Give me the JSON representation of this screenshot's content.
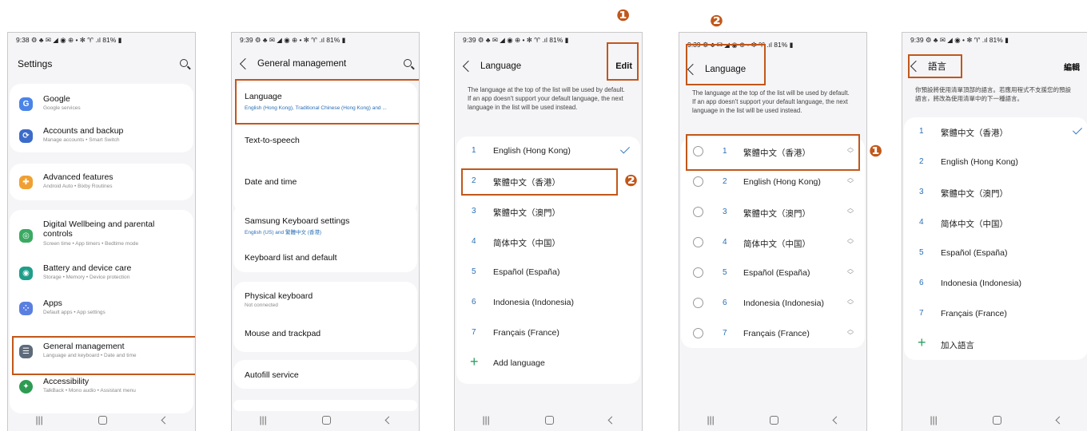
{
  "colors": {
    "accent": "#c2571a",
    "link": "#2a6fb5",
    "check": "#3c7dc2",
    "add": "#2e9e5f"
  },
  "annotations": {
    "one": "❶",
    "two": "❷"
  },
  "nav": {
    "recents": "|||",
    "home": "○",
    "back": "<"
  },
  "screen1": {
    "status": "9:38 ⚙ ♣ ✉ ◢ ◉ ⊕ •   ✻ ♈ .ıl 81% ▮",
    "title": "Settings",
    "items": [
      {
        "title": "Google",
        "sub": "Google services",
        "icon": "google-icon",
        "icon_letter": "G",
        "color": "#4a84e8"
      },
      {
        "title": "Accounts and backup",
        "sub": "Manage accounts  •  Smart Switch",
        "icon": "sync-icon",
        "icon_letter": "⟳",
        "color": "#3b6cc9"
      },
      {
        "title": "Advanced features",
        "sub": "Android Auto  •  Bixby Routines",
        "icon": "gear-plus-icon",
        "icon_letter": "✚",
        "color": "#f0a032"
      },
      {
        "title": "Digital Wellbeing and parental controls",
        "sub": "Screen time  •  App timers  •  Bedtime mode",
        "icon": "wellbeing-icon",
        "icon_letter": "◎",
        "color": "#3aaa62"
      },
      {
        "title": "Battery and device care",
        "sub": "Storage  •  Memory  •  Device protection",
        "icon": "battery-care-icon",
        "icon_letter": "◉",
        "color": "#1f9e8a"
      },
      {
        "title": "Apps",
        "sub": "Default apps  •  App settings",
        "icon": "apps-icon",
        "icon_letter": "⁘",
        "color": "#5a7fe0"
      },
      {
        "title": "General management",
        "sub": "Language and keyboard  •  Date and time",
        "icon": "sliders-icon",
        "icon_letter": "☰",
        "color": "#5d6a7a"
      },
      {
        "title": "Accessibility",
        "sub": "TalkBack  •  Mono audio  •  Assistant menu",
        "icon": "accessibility-icon",
        "icon_letter": "✦",
        "color": "#2d9b52"
      }
    ]
  },
  "screen2": {
    "status": "9:39 ⚙ ♣ ✉ ◢ ◉ ⊕ •   ✻ ♈ .ıl 81% ▮",
    "title": "General management",
    "language_title": "Language",
    "language_sub": "English (Hong Kong), Traditional Chinese (Hong Kong) and ...",
    "tts": "Text-to-speech",
    "date_time": "Date and time",
    "samsung_kb": "Samsung Keyboard settings",
    "samsung_kb_sub": "English (US) and 繁體中文 (香港)",
    "kb_list": "Keyboard list and default",
    "physical_kb": "Physical keyboard",
    "physical_kb_sub": "Not connected",
    "mouse": "Mouse and trackpad",
    "autofill": "Autofill service"
  },
  "screen3": {
    "status": "9:39 ⚙ ♣ ✉ ◢ ◉ ⊕ •   ✻ ♈ .ıl 81% ▮",
    "title": "Language",
    "edit": "Edit",
    "desc": "The language at the top of the list will be used by default. If an app doesn't support your default language, the next language in the list will be used instead.",
    "langs": [
      {
        "n": "1",
        "t": "English (Hong Kong)"
      },
      {
        "n": "2",
        "t": "繁體中文（香港）"
      },
      {
        "n": "3",
        "t": "繁體中文（澳門）"
      },
      {
        "n": "4",
        "t": "简体中文（中国）"
      },
      {
        "n": "5",
        "t": "Español (España)"
      },
      {
        "n": "6",
        "t": "Indonesia (Indonesia)"
      },
      {
        "n": "7",
        "t": "Français (France)"
      }
    ],
    "add": "Add language"
  },
  "screen4": {
    "status": "9:39 ⚙ ♣ ✉ ◢ ◉ ⊕ •   ✻ ♈ .ıl 81% ▮",
    "title": "Language",
    "desc": "The language at the top of the list will be used by default. If an app doesn't support your default language, the next language in the list will be used instead.",
    "langs": [
      {
        "n": "1",
        "t": "繁體中文（香港）"
      },
      {
        "n": "2",
        "t": "English (Hong Kong)"
      },
      {
        "n": "3",
        "t": "繁體中文（澳門）"
      },
      {
        "n": "4",
        "t": "简体中文（中国）"
      },
      {
        "n": "5",
        "t": "Español (España)"
      },
      {
        "n": "6",
        "t": "Indonesia (Indonesia)"
      },
      {
        "n": "7",
        "t": "Français (France)"
      }
    ]
  },
  "screen5": {
    "status": "9:39 ⚙ ♣ ✉ ◢ ◉   •   ✻ ♈ .ıl 81% ▮",
    "title": "語言",
    "edit": "編輯",
    "desc": "你預設將使用清單頂部的語言。若應用程式不支援您的預設語言，將改為使用清單中的下一種語言。",
    "langs": [
      {
        "n": "1",
        "t": "繁體中文（香港）"
      },
      {
        "n": "2",
        "t": "English (Hong Kong)"
      },
      {
        "n": "3",
        "t": "繁體中文（澳門）"
      },
      {
        "n": "4",
        "t": "简体中文（中国）"
      },
      {
        "n": "5",
        "t": "Español (España)"
      },
      {
        "n": "6",
        "t": "Indonesia (Indonesia)"
      },
      {
        "n": "7",
        "t": "Français (France)"
      }
    ],
    "add": "加入語言"
  }
}
